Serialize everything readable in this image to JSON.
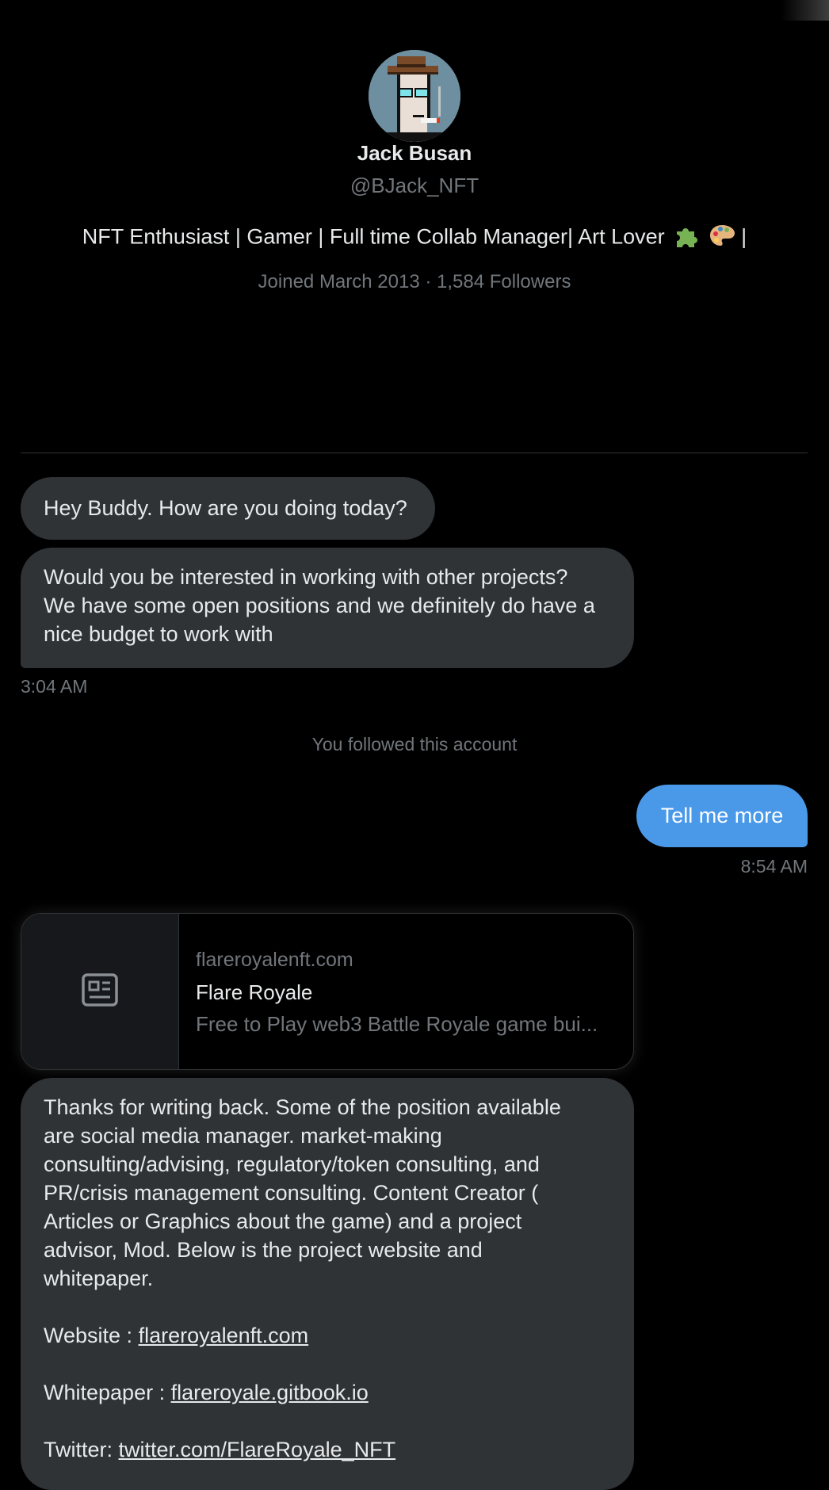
{
  "profile": {
    "name": "Jack Busan",
    "handle": "@BJack_NFT",
    "bio": "NFT Enthusiast | Gamer | Full time Collab Manager| Art Lover",
    "bio_emojis": [
      "puzzle-piece-emoji",
      "artist-palette-emoji"
    ],
    "bio_suffix": "|",
    "joined": "Joined March 2013",
    "separator": "·",
    "followers": "1,584 Followers"
  },
  "messages": {
    "msg1": "Hey Buddy. How are you doing today?",
    "msg2_lines": [
      "Would you be interested in working with other projects?",
      "We have some open positions and we definitely do have a",
      "nice budget to work with"
    ],
    "time1": "3:04 AM",
    "system_notice": "You followed this account",
    "reply": "Tell me more",
    "time2": "8:54 AM",
    "link_card": {
      "domain": "flareroyalenft.com",
      "title": "Flare Royale",
      "description": "Free to Play web3 Battle Royale game bui...",
      "icon": "article-icon"
    },
    "msg4_lines": [
      "Thanks for writing back. Some of the position available",
      "are social media manager. market-making",
      "consulting/advising, regulatory/token consulting, and",
      "PR/crisis management consulting. Content Creator (",
      "Articles or Graphics about the game) and a project",
      "advisor, Mod. Below is the project website and",
      "whitepaper."
    ],
    "website_label": "Website : ",
    "website_link": "flareroyalenft.com",
    "whitepaper_label": "Whitepaper : ",
    "whitepaper_link": "flareroyale.gitbook.io",
    "twitter_label": "Twitter: ",
    "twitter_link": "twitter.com/FlareRoyale_NFT"
  },
  "colors": {
    "background": "#000000",
    "incoming_bubble": "#2f3336",
    "outgoing_bubble": "#4a99e9",
    "muted_text": "#71767b"
  }
}
